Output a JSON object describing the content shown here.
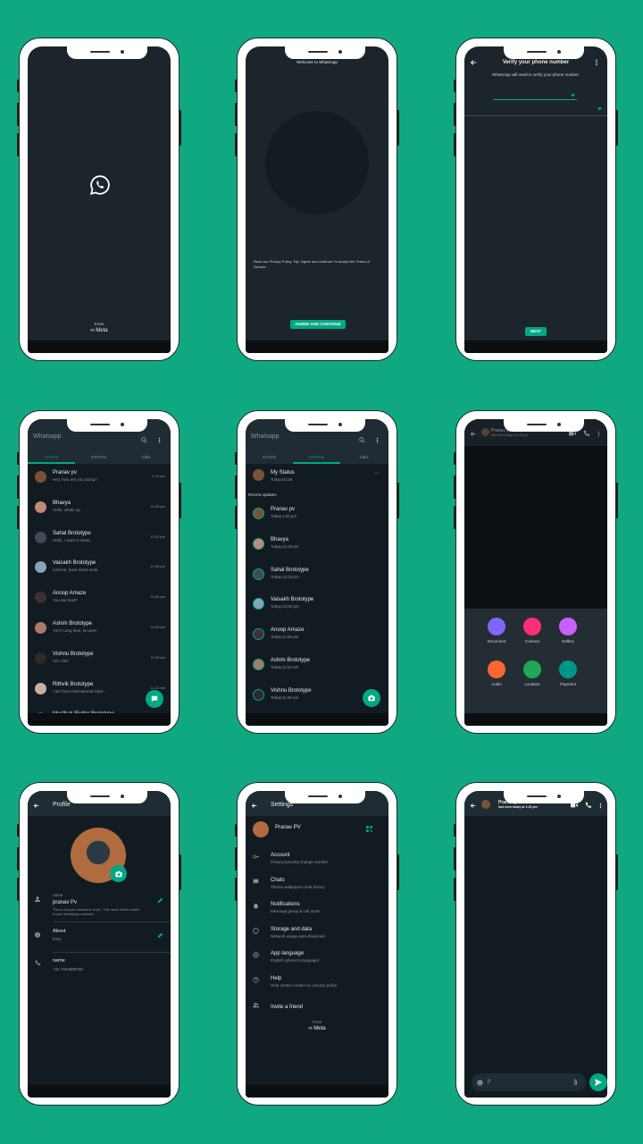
{
  "colors": {
    "background": "#10a881",
    "accent": "#00a884",
    "dark": "#121b22",
    "bar": "#1f2c34"
  },
  "splash": {
    "from": "From",
    "brand": "∞ Meta"
  },
  "welcome": {
    "title": "Welcome to WhatsApp",
    "privacy": "Read our Privacy Policy. Tap \"Agree and continue\" to accept the Terms of Service.",
    "agree": "AGREE AND CONTINUE"
  },
  "verify": {
    "title": "Verify your phone number",
    "desc": "WhatsApp will need to verify your phone number.",
    "next": "NEXT"
  },
  "chats_screen": {
    "app_title": "Whatsapp",
    "tabs": [
      "CHATS",
      "STATUS",
      "Calls"
    ],
    "items": [
      {
        "name": "Pranav pv",
        "msg": "Hey, how are you doing?",
        "time": "1:23 pm"
      },
      {
        "name": "Bhavya",
        "msg": "Hello, whats up",
        "time": "12:45 pm"
      },
      {
        "name": "Sahal Brototype",
        "msg": "Hello, I want to sleep",
        "time": "12:03 pm"
      },
      {
        "name": "Vaisakh Brototype",
        "msg": "Call me, have some work",
        "time": "12:00 pm"
      },
      {
        "name": "Anoop Amaze",
        "msg": "You ate food?",
        "time": "11:59 am"
      },
      {
        "name": "Ashim Brototype",
        "msg": "Yo!!!! Long time, no see!!",
        "time": "11:53 am"
      },
      {
        "name": "Vishnu Brototype",
        "msg": "Am I fat?",
        "time": "11:25 am"
      },
      {
        "name": "Rithvik Brototype",
        "msg": "I am from International Olym...",
        "time": "11:22 am"
      },
      {
        "name": "Musthak Flutter Brototype",
        "msg": "",
        "time": ""
      }
    ]
  },
  "status_screen": {
    "app_title": "Whatsapp",
    "tabs": [
      "CHATS",
      "STATUS",
      "Calls"
    ],
    "my_status": {
      "name": "My Status",
      "time": "Today,03:45"
    },
    "recent_label": "Recent updates",
    "items": [
      {
        "name": "Pranav pv",
        "time": "Today,1:25 pm"
      },
      {
        "name": "Bhavya",
        "time": "Today,12:45 pm"
      },
      {
        "name": "Sahal Brototype",
        "time": "Today,12:03 pm"
      },
      {
        "name": "Vaisakh Brototype",
        "time": "Today,12:00 pm"
      },
      {
        "name": "Anoop Amaze",
        "time": "Today,11:59 am"
      },
      {
        "name": "Ashim Brototype",
        "time": "Today,11:53 am"
      },
      {
        "name": "Vishnu Brototype",
        "time": "Today,11:25 am"
      }
    ]
  },
  "attach_screen": {
    "contact": "Pranav pv",
    "last_seen": "last seen today at 1:23 pm",
    "options": [
      {
        "label": "Document",
        "color": "#7f66ff"
      },
      {
        "label": "Camera",
        "color": "#fe2e74"
      },
      {
        "label": "Gallery",
        "color": "#c861fa"
      },
      {
        "label": "Audio",
        "color": "#f96533"
      },
      {
        "label": "Location",
        "color": "#1fa855"
      },
      {
        "label": "Payment",
        "color": "#009688"
      }
    ]
  },
  "profile": {
    "title": "Profile",
    "name_label": "name",
    "name_value": "pranav Pv",
    "name_hint": "This is not your username or pin. This name will be visible to your WhatsApp contacts.",
    "about_label": "About",
    "about_value": "busy",
    "phone_label": "name",
    "phone_value": "+91 7034888758"
  },
  "settings": {
    "title": "Settings",
    "user": "Pranav PV",
    "items": [
      {
        "title": "Account",
        "sub": "Privacy,Security,change number",
        "icon": "key-icon"
      },
      {
        "title": "Chats",
        "sub": "Theme,wallpapers,chat history",
        "icon": "chat-icon"
      },
      {
        "title": "Notifications",
        "sub": "Message,group & call tones",
        "icon": "bell-icon"
      },
      {
        "title": "Storage and data",
        "sub": "Network usage,auto-download",
        "icon": "storage-icon"
      },
      {
        "title": "App language",
        "sub": "English (phone's language)",
        "icon": "globe-icon"
      },
      {
        "title": "Help",
        "sub": "Help centre,contact us, privacy policy",
        "icon": "help-icon"
      },
      {
        "title": "Invite a friend",
        "sub": "",
        "icon": "people-icon"
      }
    ],
    "from": "From",
    "brand": "∞ Meta"
  },
  "chat_screen": {
    "contact": "Pranav pv",
    "last_seen": "last seen today at 1:23 pm",
    "input": "p"
  }
}
